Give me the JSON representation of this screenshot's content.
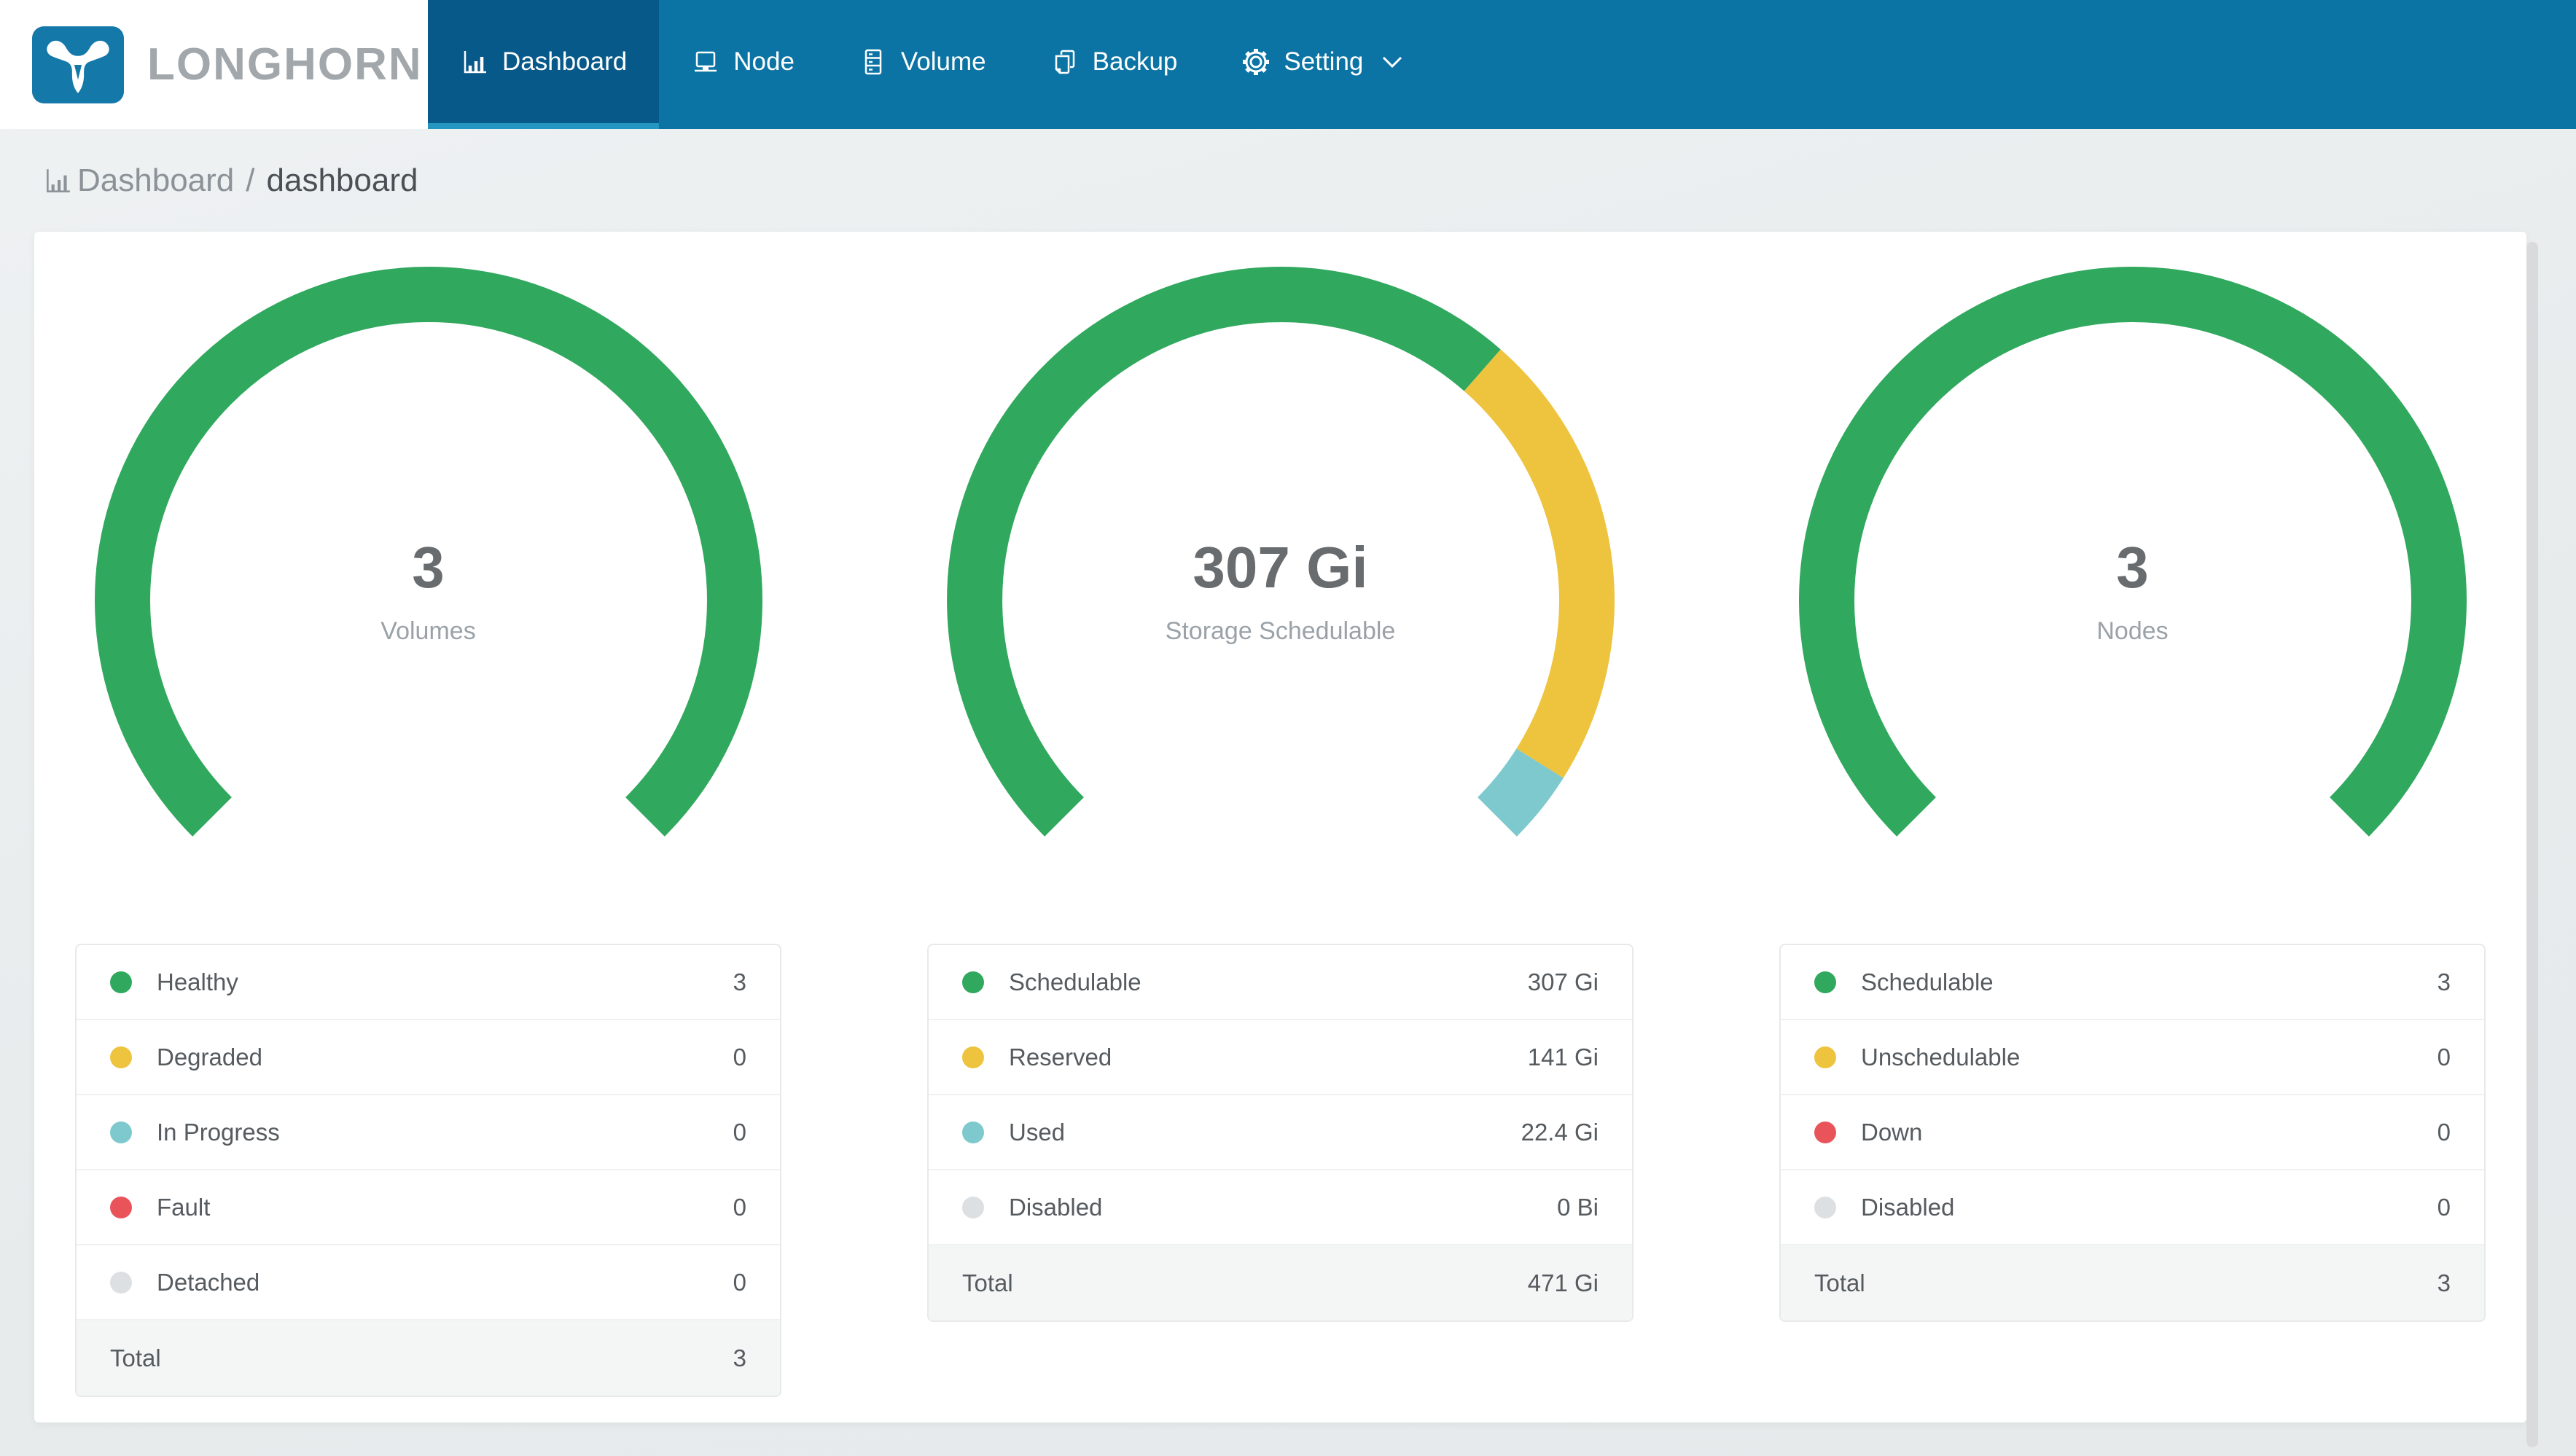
{
  "app": {
    "brand": "LONGHORN"
  },
  "nav": {
    "items": [
      {
        "label": "Dashboard",
        "icon": "bar-chart-icon",
        "active": true
      },
      {
        "label": "Node",
        "icon": "node-icon",
        "active": false
      },
      {
        "label": "Volume",
        "icon": "volume-icon",
        "active": false
      },
      {
        "label": "Backup",
        "icon": "backup-icon",
        "active": false
      },
      {
        "label": "Setting",
        "icon": "gear-icon",
        "active": false,
        "dropdown": true
      }
    ]
  },
  "breadcrumb": {
    "icon": "bar-chart-icon",
    "section": "Dashboard",
    "separator": "/",
    "current": "dashboard"
  },
  "colors": {
    "navbar": "#0b74a4",
    "nav_active_bg": "#07598a",
    "nav_active_border": "#2397c2",
    "green": "#30a85e",
    "yellow": "#eec33e",
    "teal": "#7ec9cd",
    "red": "#e9545b",
    "gray": "#dde0e2"
  },
  "chart_data": [
    {
      "type": "gauge",
      "arc_span_deg": 270,
      "start_angle_deg": 225,
      "center_value": "3",
      "center_label": "Volumes",
      "segments": [
        {
          "label": "Healthy",
          "value": 3,
          "display": "3",
          "color": "#30a85e"
        },
        {
          "label": "Degraded",
          "value": 0,
          "display": "0",
          "color": "#eec33e"
        },
        {
          "label": "In Progress",
          "value": 0,
          "display": "0",
          "color": "#7ec9cd"
        },
        {
          "label": "Fault",
          "value": 0,
          "display": "0",
          "color": "#e9545b"
        },
        {
          "label": "Detached",
          "value": 0,
          "display": "0",
          "color": "#dde0e2"
        }
      ],
      "total": {
        "label": "Total",
        "display": "3"
      }
    },
    {
      "type": "gauge",
      "arc_span_deg": 270,
      "start_angle_deg": 225,
      "center_value": "307 Gi",
      "center_label": "Storage Schedulable",
      "segments": [
        {
          "label": "Schedulable",
          "value": 307,
          "display": "307 Gi",
          "color": "#30a85e"
        },
        {
          "label": "Reserved",
          "value": 141,
          "display": "141 Gi",
          "color": "#eec33e"
        },
        {
          "label": "Used",
          "value": 22.4,
          "display": "22.4 Gi",
          "color": "#7ec9cd"
        },
        {
          "label": "Disabled",
          "value": 0,
          "display": "0 Bi",
          "color": "#dde0e2"
        }
      ],
      "total": {
        "label": "Total",
        "display": "471 Gi"
      }
    },
    {
      "type": "gauge",
      "arc_span_deg": 270,
      "start_angle_deg": 225,
      "center_value": "3",
      "center_label": "Nodes",
      "segments": [
        {
          "label": "Schedulable",
          "value": 3,
          "display": "3",
          "color": "#30a85e"
        },
        {
          "label": "Unschedulable",
          "value": 0,
          "display": "0",
          "color": "#eec33e"
        },
        {
          "label": "Down",
          "value": 0,
          "display": "0",
          "color": "#e9545b"
        },
        {
          "label": "Disabled",
          "value": 0,
          "display": "0",
          "color": "#dde0e2"
        }
      ],
      "total": {
        "label": "Total",
        "display": "3"
      }
    }
  ]
}
